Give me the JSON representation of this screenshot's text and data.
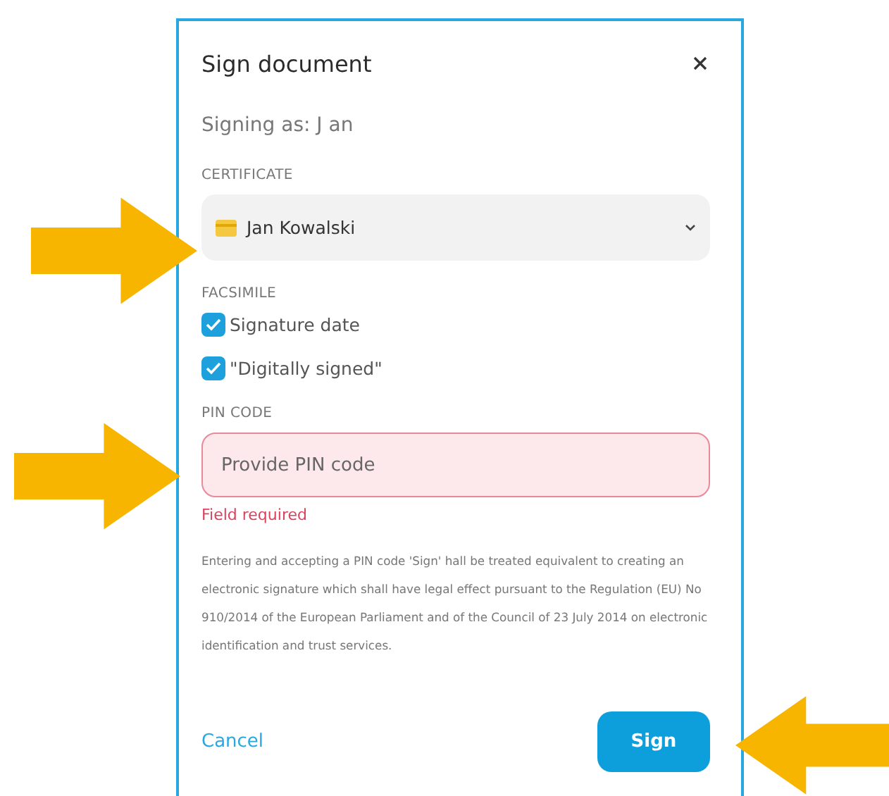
{
  "dialog": {
    "title": "Sign document",
    "signing_as": "Signing as: J an"
  },
  "certificate": {
    "label": "CERTIFICATE",
    "value": "Jan Kowalski"
  },
  "facsimile": {
    "label": "FACSIMILE",
    "options": [
      {
        "label": "Signature date",
        "checked": true
      },
      {
        "label": "\"Digitally signed\"",
        "checked": true
      }
    ]
  },
  "pin": {
    "label": "PIN CODE",
    "placeholder": "Provide PIN code",
    "invalid": true,
    "error": "Field required"
  },
  "notice": "Entering and accepting a PIN code 'Sign' hall be treated equivalent to creating an electronic signature which shall have legal effect pursuant to the Regulation (EU) No 910/2014 of the European Parliament and of the Council of 23 July 2014 on electronic identification and trust services.",
  "buttons": {
    "cancel": "Cancel",
    "sign": "Sign"
  }
}
